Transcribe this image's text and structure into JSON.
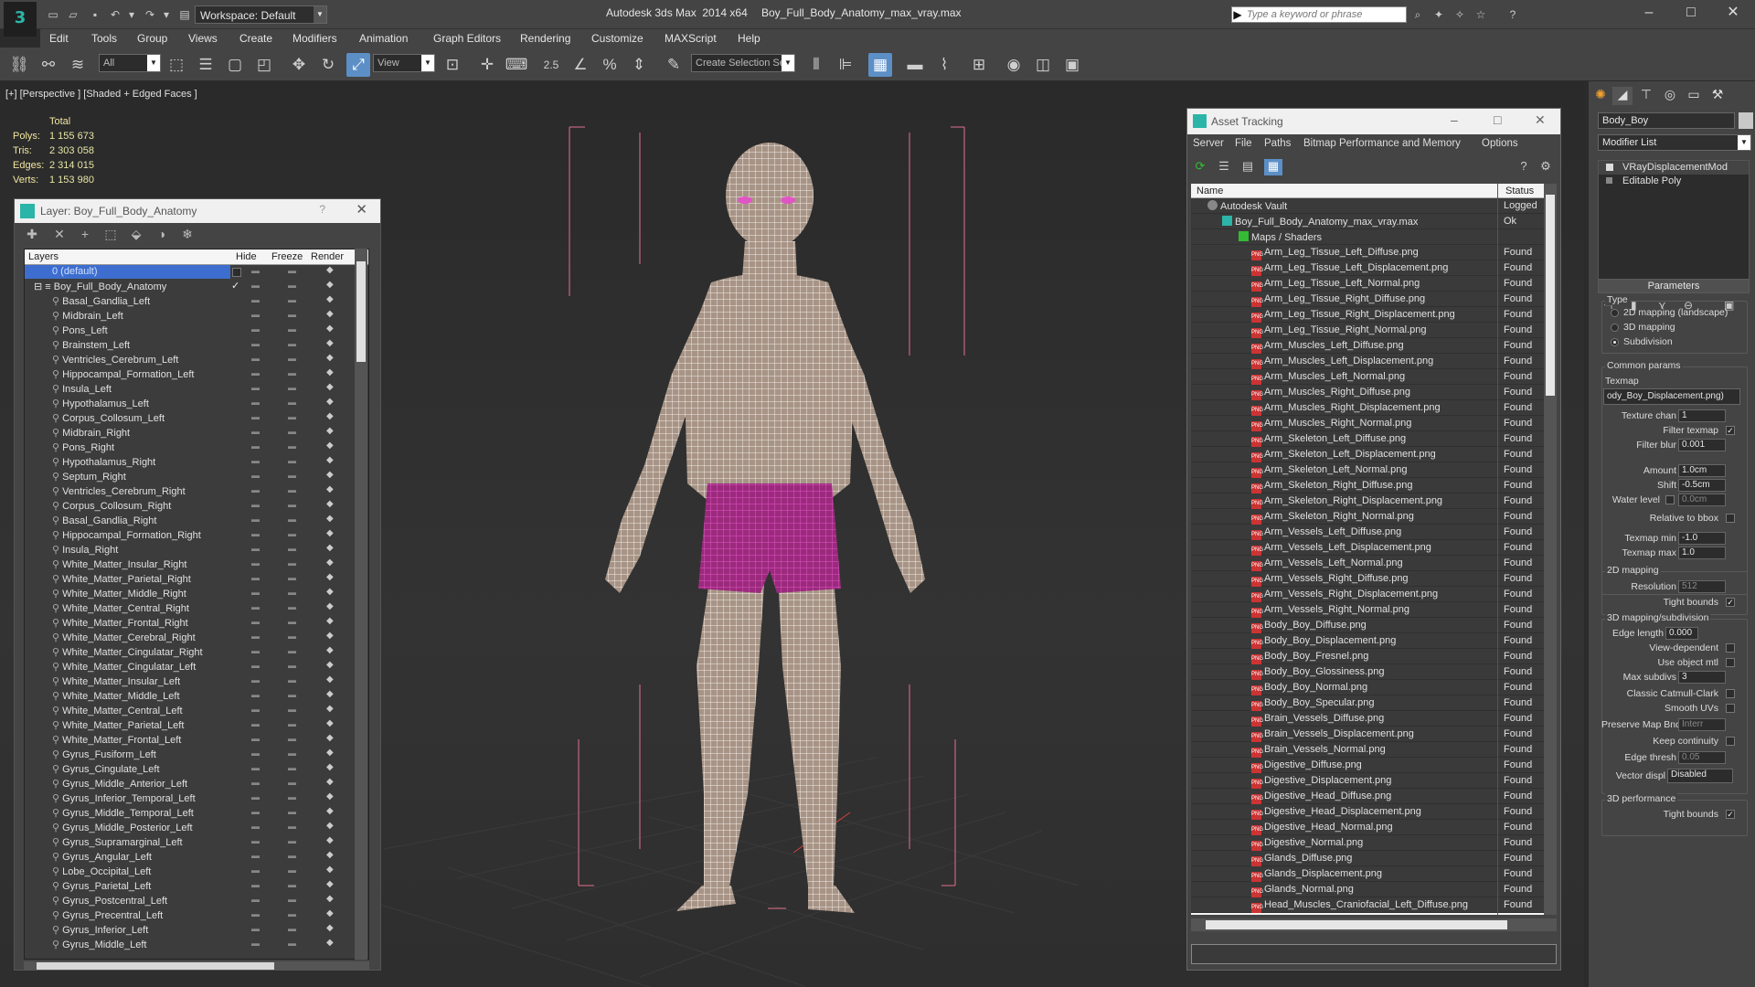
{
  "titlebar": {
    "app_title": "Autodesk 3ds Max  2014 x64",
    "file_title": "Boy_Full_Body_Anatomy_max_vray.max",
    "workspace": "Workspace: Default",
    "search_placeholder": "Type a keyword or phrase"
  },
  "menu": [
    "Edit",
    "Tools",
    "Group",
    "Views",
    "Create",
    "Modifiers",
    "Animation",
    "Graph Editors",
    "Rendering",
    "Customize",
    "MAXScript",
    "Help"
  ],
  "toolbar": {
    "filter_dropdown": "All",
    "view_dropdown": "View",
    "selection_set": "Create Selection Se",
    "snap_label": "2.5"
  },
  "viewport": {
    "label": "[+] [Perspective ] [Shaded + Edged Faces ]",
    "stats_header": "Total",
    "stats": [
      {
        "k": "Polys:",
        "v": "1 155 673"
      },
      {
        "k": "Tris:",
        "v": "2 303 058"
      },
      {
        "k": "Edges:",
        "v": "2 314 015"
      },
      {
        "k": "Verts:",
        "v": "1 153 980"
      }
    ]
  },
  "layer_panel": {
    "title": "Layer: Boy_Full_Body_Anatomy",
    "help": "?",
    "columns": {
      "layers": "Layers",
      "hide": "Hide",
      "freeze": "Freeze",
      "render": "Render"
    },
    "default_layer": "0 (default)",
    "root_layer": "Boy_Full_Body_Anatomy",
    "layers": [
      "Basal_Gandlia_Left",
      "Midbrain_Left",
      "Pons_Left",
      "Brainstem_Left",
      "Ventricles_Cerebrum_Left",
      "Hippocampal_Formation_Left",
      "Insula_Left",
      "Hypothalamus_Left",
      "Corpus_Collosum_Left",
      "Midbrain_Right",
      "Pons_Right",
      "Hypothalamus_Right",
      "Septum_Right",
      "Ventricles_Cerebrum_Right",
      "Corpus_Collosum_Right",
      "Basal_Gandlia_Right",
      "Hippocampal_Formation_Right",
      "Insula_Right",
      "White_Matter_Insular_Right",
      "White_Matter_Parietal_Right",
      "White_Matter_Middle_Right",
      "White_Matter_Central_Right",
      "White_Matter_Frontal_Right",
      "White_Matter_Cerebral_Right",
      "White_Matter_Cingulatar_Right",
      "White_Matter_Cingulatar_Left",
      "White_Matter_Insular_Left",
      "White_Matter_Middle_Left",
      "White_Matter_Central_Left",
      "White_Matter_Parietal_Left",
      "White_Matter_Frontal_Left",
      "Gyrus_Fusiform_Left",
      "Gyrus_Cingulate_Left",
      "Gyrus_Middle_Anterior_Left",
      "Gyrus_Inferior_Temporal_Left",
      "Gyrus_Middle_Temporal_Left",
      "Gyrus_Middle_Posterior_Left",
      "Gyrus_Supramarginal_Left",
      "Gyrus_Angular_Left",
      "Lobe_Occipital_Left",
      "Gyrus_Parietal_Left",
      "Gyrus_Postcentral_Left",
      "Gyrus_Precentral_Left",
      "Gyrus_Inferior_Left",
      "Gyrus_Middle_Left"
    ]
  },
  "asset_panel": {
    "title": "Asset Tracking",
    "menu": [
      "Server",
      "File",
      "Paths",
      "Bitmap Performance and Memory",
      "Options"
    ],
    "columns": {
      "name": "Name",
      "status": "Status"
    },
    "vault": {
      "name": "Autodesk Vault",
      "status": "Logged"
    },
    "file": {
      "name": "Boy_Full_Body_Anatomy_max_vray.max",
      "status": "Ok"
    },
    "folder": "Maps / Shaders",
    "status_found": "Found",
    "maps": [
      "Arm_Leg_Tissue_Left_Diffuse.png",
      "Arm_Leg_Tissue_Left_Displacement.png",
      "Arm_Leg_Tissue_Left_Normal.png",
      "Arm_Leg_Tissue_Right_Diffuse.png",
      "Arm_Leg_Tissue_Right_Displacement.png",
      "Arm_Leg_Tissue_Right_Normal.png",
      "Arm_Muscles_Left_Diffuse.png",
      "Arm_Muscles_Left_Displacement.png",
      "Arm_Muscles_Left_Normal.png",
      "Arm_Muscles_Right_Diffuse.png",
      "Arm_Muscles_Right_Displacement.png",
      "Arm_Muscles_Right_Normal.png",
      "Arm_Skeleton_Left_Diffuse.png",
      "Arm_Skeleton_Left_Displacement.png",
      "Arm_Skeleton_Left_Normal.png",
      "Arm_Skeleton_Right_Diffuse.png",
      "Arm_Skeleton_Right_Displacement.png",
      "Arm_Skeleton_Right_Normal.png",
      "Arm_Vessels_Left_Diffuse.png",
      "Arm_Vessels_Left_Displacement.png",
      "Arm_Vessels_Left_Normal.png",
      "Arm_Vessels_Right_Diffuse.png",
      "Arm_Vessels_Right_Displacement.png",
      "Arm_Vessels_Right_Normal.png",
      "Body_Boy_Diffuse.png",
      "Body_Boy_Displacement.png",
      "Body_Boy_Fresnel.png",
      "Body_Boy_Glossiness.png",
      "Body_Boy_Normal.png",
      "Body_Boy_Specular.png",
      "Brain_Vessels_Diffuse.png",
      "Brain_Vessels_Displacement.png",
      "Brain_Vessels_Normal.png",
      "Digestive_Diffuse.png",
      "Digestive_Displacement.png",
      "Digestive_Head_Diffuse.png",
      "Digestive_Head_Displacement.png",
      "Digestive_Head_Normal.png",
      "Digestive_Normal.png",
      "Glands_Diffuse.png",
      "Glands_Displacement.png",
      "Glands_Normal.png",
      "Head_Muscles_Craniofacial_Left_Diffuse.png"
    ]
  },
  "command_panel": {
    "object_name": "Body_Boy",
    "modifier_list": "Modifier List",
    "stack": [
      "VRayDisplacementMod",
      "Editable Poly"
    ],
    "parameters_title": "Parameters",
    "type_group": "Type",
    "type_options": [
      "2D mapping (landscape)",
      "3D mapping",
      "Subdivision"
    ],
    "common_group": "Common params",
    "texmap_label": "Texmap",
    "texmap_value": "ody_Boy_Displacement.png)",
    "texture_chan": {
      "label": "Texture chan",
      "value": "1"
    },
    "filter_texmap": "Filter texmap",
    "filter_blur": {
      "label": "Filter blur",
      "value": "0.001"
    },
    "amount": {
      "label": "Amount",
      "value": "1.0cm"
    },
    "shift": {
      "label": "Shift",
      "value": "-0.5cm"
    },
    "water_level": {
      "label": "Water level",
      "value": "0.0cm"
    },
    "relative_bbox": "Relative to bbox",
    "texmap_min": {
      "label": "Texmap min",
      "value": "-1.0"
    },
    "texmap_max": {
      "label": "Texmap max",
      "value": "1.0"
    },
    "mapping2d_group": "2D mapping",
    "resolution": {
      "label": "Resolution",
      "value": "512"
    },
    "tight_bounds": "Tight bounds",
    "mapping3d_group": "3D mapping/subdivision",
    "edge_length": {
      "label": "Edge length",
      "value": "0.000"
    },
    "view_dependent": "View-dependent",
    "use_object_mtl": "Use object mtl",
    "max_subdivs": {
      "label": "Max subdivs",
      "value": "3"
    },
    "classic_catmull": "Classic Catmull-Clark",
    "smooth_uvs": "Smooth UVs",
    "preserve_map_bnd": {
      "label": "Preserve Map Bnd",
      "value": "Interr"
    },
    "keep_continuity": "Keep continuity",
    "edge_thresh": {
      "label": "Edge thresh",
      "value": "0.05"
    },
    "vector_displ": {
      "label": "Vector displ",
      "value": "Disabled"
    },
    "perf_group": "3D performance",
    "tight_bounds_2": "Tight bounds"
  }
}
